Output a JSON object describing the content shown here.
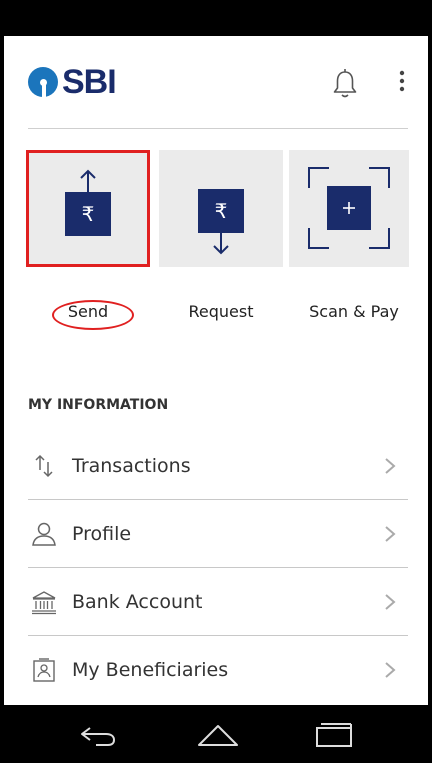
{
  "app": {
    "brand": "SBI",
    "accent_color": "#1a2c6b",
    "highlight_color": "#e02020"
  },
  "header": {
    "notification_icon": "bell-icon",
    "menu_icon": "more-vert-icon"
  },
  "actions": [
    {
      "label": "Send",
      "icon": "send-rupee-icon"
    },
    {
      "label": "Request",
      "icon": "request-rupee-icon"
    },
    {
      "label": "Scan & Pay",
      "icon": "scan-qr-icon"
    }
  ],
  "section": {
    "heading": "MY INFORMATION"
  },
  "menu": [
    {
      "label": "Transactions",
      "icon": "transactions-arrows-icon"
    },
    {
      "label": "Profile",
      "icon": "user-icon"
    },
    {
      "label": "Bank Account",
      "icon": "bank-icon"
    },
    {
      "label": "My Beneficiaries",
      "icon": "contact-card-icon"
    }
  ],
  "navbar": {
    "back_icon": "back-icon",
    "home_icon": "home-icon",
    "recent_icon": "recent-apps-icon"
  }
}
